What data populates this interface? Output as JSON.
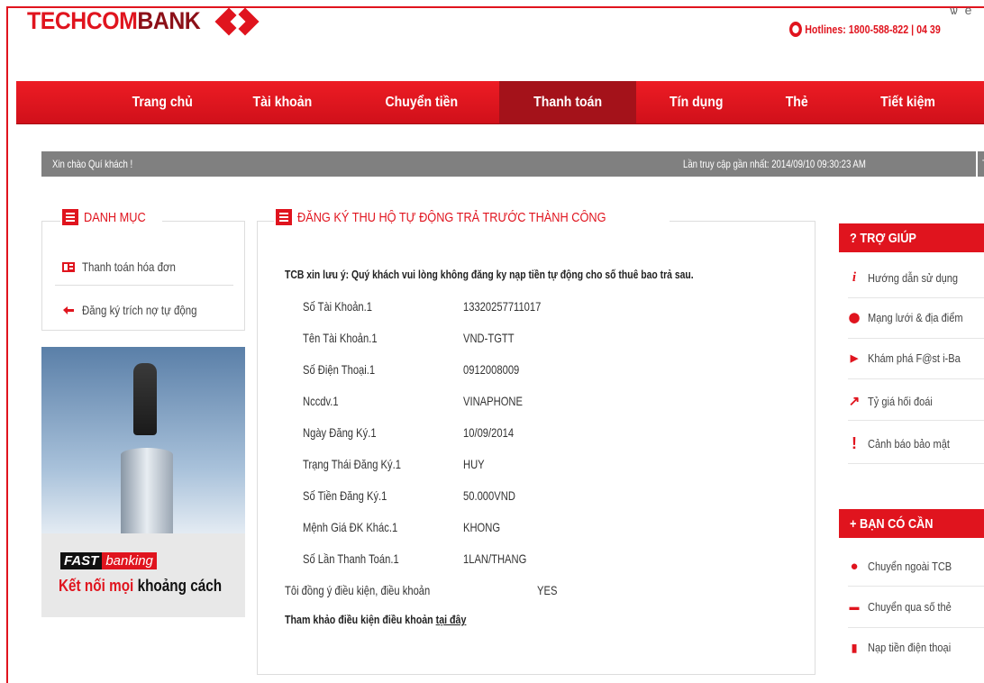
{
  "header": {
    "logo_text_1": "TECHCOM",
    "logo_text_2": "BANK",
    "top_icons": "ѡ e",
    "hotline": "Hotlines: 1800-588-822 | 04 39"
  },
  "nav": {
    "items": [
      {
        "label": "Trang chủ"
      },
      {
        "label": "Tài khoản"
      },
      {
        "label": "Chuyển tiền"
      },
      {
        "label": "Thanh toán"
      },
      {
        "label": "Tín dụng"
      },
      {
        "label": "Thẻ"
      },
      {
        "label": "Tiết kiệm"
      }
    ],
    "active": "Thanh toán"
  },
  "greeting": {
    "left": "Xin chào Quí khách !",
    "right": "Lần truy cập gần nhất: 2014/09/10 09:30:23 AM",
    "tail": "T"
  },
  "sidebar": {
    "title": "DANH MỤC",
    "items": [
      {
        "label": "Thanh toán hóa đơn",
        "icon": "bill-icon"
      },
      {
        "label": "Đăng ký trích nợ tự động",
        "icon": "auto-debit-icon"
      }
    ]
  },
  "banner": {
    "fast": "FAST",
    "banking": "banking",
    "slogan_red": "Kết nối mọi",
    "slogan_dark": "khoảng cách"
  },
  "main": {
    "title": "ĐĂNG KÝ THU HỘ TỰ ĐỘNG TRẢ TRƯỚC THÀNH CÔNG",
    "note": "TCB xin lưu ý: Quý khách vui lòng không đăng ky nạp tiền tự động cho số thuê bao trả sau.",
    "fields": [
      {
        "label": "Số Tài Khoản.1",
        "value": "13320257711017"
      },
      {
        "label": "Tên Tài Khoản.1",
        "value": "VND-TGTT"
      },
      {
        "label": "Số Điện Thoại.1",
        "value": "0912008009"
      },
      {
        "label": "Nccdv.1",
        "value": "VINAPHONE"
      },
      {
        "label": "Ngày Đăng Ký.1",
        "value": "10/09/2014"
      },
      {
        "label": "Trạng Thái Đăng Ký.1",
        "value": "HUY"
      },
      {
        "label": "Số Tiền Đăng Ký.1",
        "value": "50.000VND"
      },
      {
        "label": "Mệnh Giá ĐK Khác.1",
        "value": "KHONG"
      },
      {
        "label": "Số Lần Thanh Toán.1",
        "value": "1LAN/THANG"
      }
    ],
    "agree_label": "Tôi đồng ý điều kiện, điều khoản",
    "agree_value": "YES",
    "terms_text": "Tham khảo điều kiện điều khoản ",
    "terms_link": "tại đây"
  },
  "help": {
    "title": "? TRỢ GIÚP",
    "items": [
      {
        "label": "Hướng dẫn sử dụng",
        "icon": "info-icon",
        "glyph": "i"
      },
      {
        "label": "Mạng lưới & địa điểm",
        "icon": "location-pin-icon",
        "glyph": "⬤"
      },
      {
        "label": "Khám phá F@st i-Ba",
        "icon": "play-icon",
        "glyph": "▶"
      },
      {
        "label": "Tỷ giá hối đoái",
        "icon": "trend-icon",
        "glyph": "↗"
      },
      {
        "label": "Cảnh báo bảo mật",
        "icon": "warning-icon",
        "glyph": "!"
      }
    ]
  },
  "need": {
    "title": "+ BẠN CÓ CẦN",
    "items": [
      {
        "label": "Chuyển ngoài TCB",
        "icon": "transfer-out-icon",
        "glyph": "●"
      },
      {
        "label": "Chuyển qua số thẻ",
        "icon": "card-transfer-icon",
        "glyph": "▬"
      },
      {
        "label": "Nạp tiền điện thoại",
        "icon": "phone-topup-icon",
        "glyph": "▮"
      }
    ]
  },
  "colors": {
    "brand_red": "#e0141e",
    "active_nav": "#a4121a",
    "greet_bar": "#808080"
  }
}
